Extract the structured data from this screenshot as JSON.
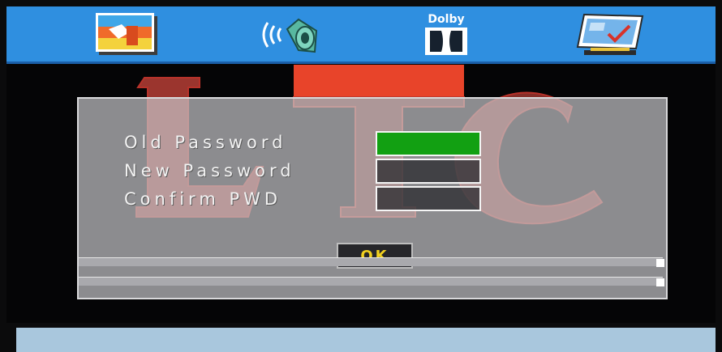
{
  "colors": {
    "topbar": "#2f8fe0",
    "field_active": "#12a012",
    "ok_text": "#f2d11e",
    "logo_red": "#d93a1c"
  },
  "top_menu": {
    "icons": [
      "picture-settings-icon",
      "audio-speaker-icon",
      "dolby-icon",
      "preferences-icon"
    ],
    "dolby_text": "Dolby"
  },
  "background_logo": {
    "text": "LTC"
  },
  "dialog": {
    "fields": [
      {
        "label": "Old Password",
        "value": "",
        "active": true
      },
      {
        "label": "New Password",
        "value": "",
        "active": false
      },
      {
        "label": "Confirm PWD",
        "value": "",
        "active": false
      }
    ],
    "ok_label": "OK"
  }
}
